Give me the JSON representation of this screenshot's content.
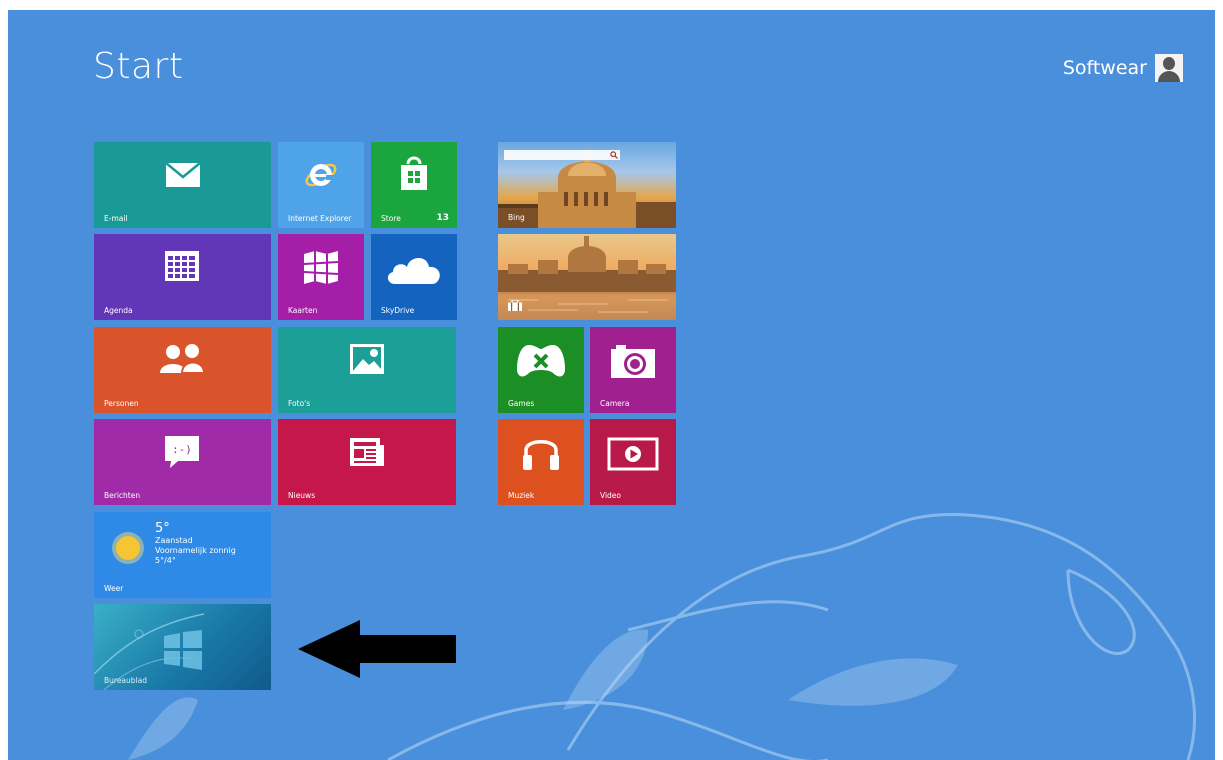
{
  "start": {
    "title": "Start"
  },
  "user": {
    "name": "Softwear"
  },
  "tiles": {
    "email": {
      "label": "E-mail",
      "color": "#1a9a96",
      "icon": "mail-icon"
    },
    "ie": {
      "label": "Internet Explorer",
      "color": "#4fa3e8",
      "icon": "internet-explorer-icon"
    },
    "store": {
      "label": "Store",
      "badge": "13",
      "color": "#1aa53e",
      "icon": "store-bag-icon"
    },
    "agenda": {
      "label": "Agenda",
      "color": "#6237b7",
      "icon": "calendar-icon"
    },
    "kaarten": {
      "label": "Kaarten",
      "color": "#a51ea7",
      "icon": "map-icon"
    },
    "skydrive": {
      "label": "SkyDrive",
      "color": "#1464bf",
      "icon": "cloud-icon"
    },
    "personen": {
      "label": "Personen",
      "color": "#d9542a",
      "icon": "people-icon"
    },
    "fotos": {
      "label": "Foto's",
      "color": "#1c9f97",
      "icon": "photo-icon"
    },
    "berichten": {
      "label": "Berichten",
      "color": "#a02aa8",
      "icon": "message-icon"
    },
    "nieuws": {
      "label": "Nieuws",
      "color": "#c5174a",
      "icon": "newspaper-icon"
    },
    "weer": {
      "label": "Weer",
      "temperature": "5°",
      "city": "Zaanstad",
      "condition": "Voornamelijk zonnig",
      "range": "5°/4°",
      "color": "#2e8ae6",
      "icon": "sun-icon"
    },
    "bureaublad": {
      "label": "Bureaublad",
      "color": "#1a7aa8",
      "icon": "windows-logo-icon"
    },
    "bing": {
      "label": "Bing",
      "icon": "search-icon"
    },
    "reizen": {
      "icon": "suitcase-icon"
    },
    "games": {
      "label": "Games",
      "color": "#1b8f26",
      "icon": "gamepad-icon"
    },
    "camera": {
      "label": "Camera",
      "color": "#a0208f",
      "icon": "camera-icon"
    },
    "muziek": {
      "label": "Muziek",
      "color": "#dd5120",
      "icon": "headphones-icon"
    },
    "video": {
      "label": "Video",
      "color": "#b71a48",
      "icon": "play-icon"
    }
  }
}
